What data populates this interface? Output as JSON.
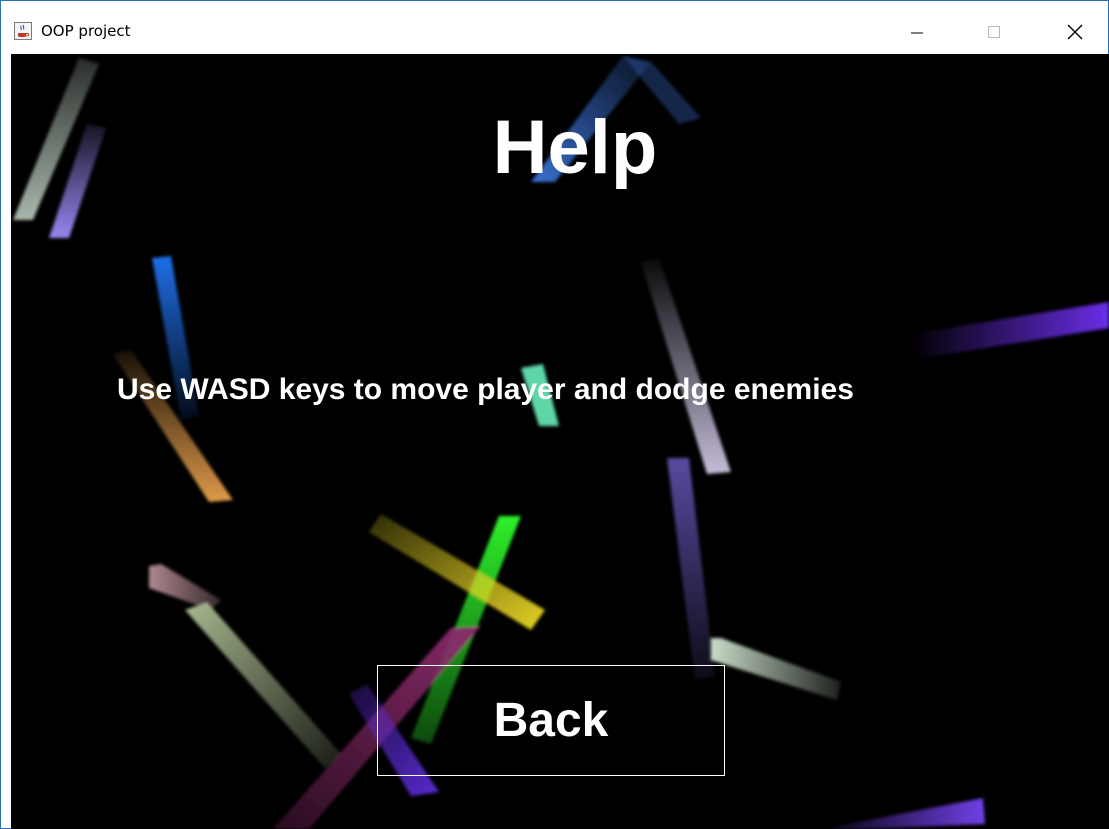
{
  "window": {
    "title": "OOP project",
    "app_icon": "java-cup-icon",
    "controls": {
      "minimize_icon": "minimize-icon",
      "maximize_icon": "maximize-icon",
      "close_icon": "close-icon"
    }
  },
  "screen": {
    "heading": "Help",
    "instructions": "Use WASD keys to move player and dodge enemies",
    "back_label": "Back"
  },
  "colors": {
    "background": "#000000",
    "text": "#ffffff",
    "window_border": "#2b6fb6"
  },
  "enemies": [
    {
      "name": "enemy-sage",
      "color": "#a9b8ad"
    },
    {
      "name": "enemy-lavender",
      "color": "#9a86f0"
    },
    {
      "name": "enemy-blue",
      "color": "#1f6ee8"
    },
    {
      "name": "enemy-orange",
      "color": "#e09a4a"
    },
    {
      "name": "enemy-steel-blue",
      "color": "#3a6fd0"
    },
    {
      "name": "enemy-mint",
      "color": "#5fd6a8"
    },
    {
      "name": "enemy-lilac",
      "color": "#c4bcd8"
    },
    {
      "name": "enemy-violet",
      "color": "#6a2de8"
    },
    {
      "name": "enemy-slate",
      "color": "#5a4aa0"
    },
    {
      "name": "enemy-yellow",
      "color": "#e6d324"
    },
    {
      "name": "enemy-green",
      "color": "#2ef02a"
    },
    {
      "name": "enemy-mauve",
      "color": "#b08890"
    },
    {
      "name": "enemy-olive",
      "color": "#a8b890"
    },
    {
      "name": "enemy-pale-green",
      "color": "#c8dcc8"
    },
    {
      "name": "enemy-magenta",
      "color": "#8a2a6a"
    },
    {
      "name": "enemy-indigo",
      "color": "#5a2ad0"
    },
    {
      "name": "enemy-purple",
      "color": "#7040e8"
    }
  ]
}
